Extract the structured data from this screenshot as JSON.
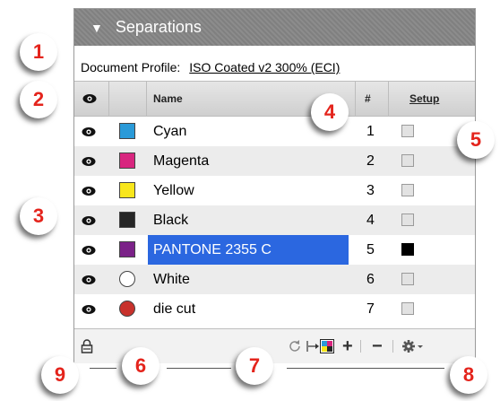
{
  "panel": {
    "title": "Separations",
    "collapse_glyph": "▼",
    "profile_label": "Document Profile:",
    "profile_value": "ISO Coated v2 300% (ECI)"
  },
  "header": {
    "eye_icon": "eye-icon",
    "name": "Name",
    "num": "#",
    "setup": "Setup"
  },
  "rows": [
    {
      "name": "Cyan",
      "num": "1",
      "color": "#2a9ad8",
      "shape": "square",
      "setup": false,
      "selected": false
    },
    {
      "name": "Magenta",
      "num": "2",
      "color": "#d8267f",
      "shape": "square",
      "setup": false,
      "selected": false
    },
    {
      "name": "Yellow",
      "num": "3",
      "color": "#f8e61c",
      "shape": "square",
      "setup": false,
      "selected": false
    },
    {
      "name": "Black",
      "num": "4",
      "color": "#262626",
      "shape": "square",
      "setup": false,
      "selected": false
    },
    {
      "name": "PANTONE 2355 C",
      "num": "5",
      "color": "#7b2288",
      "shape": "square",
      "setup": true,
      "selected": true
    },
    {
      "name": "White",
      "num": "6",
      "color": "#ffffff",
      "shape": "circle",
      "setup": false,
      "selected": false
    },
    {
      "name": "die cut",
      "num": "7",
      "color": "#c8322c",
      "shape": "circle",
      "setup": false,
      "selected": false
    }
  ],
  "footer": {
    "lock_icon": "lock-icon",
    "refresh_icon": "refresh-icon",
    "add": "+",
    "remove": "−",
    "gear_icon": "gear-icon"
  },
  "callouts": [
    "1",
    "2",
    "3",
    "4",
    "5",
    "6",
    "7",
    "8",
    "9"
  ],
  "colors": {
    "accent": "#e4241c",
    "selection": "#2b67e0",
    "title_bar": "#858585"
  }
}
